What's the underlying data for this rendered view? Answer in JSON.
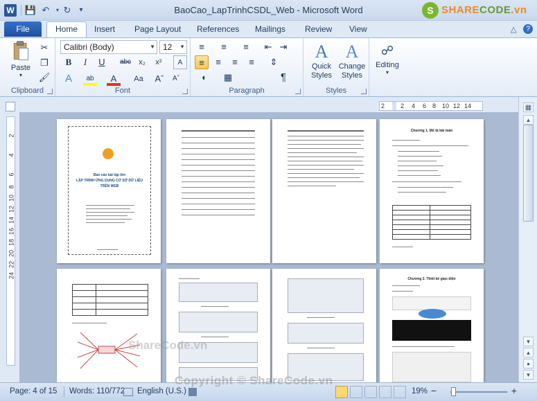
{
  "window": {
    "title": "BaoCao_LapTrinhCSDL_Web  -  Microsoft Word",
    "app_icon": "W",
    "brand_text_1": "SHARE",
    "brand_text_2": "CODE",
    "brand_text_3": ".vn"
  },
  "tabs": {
    "file": "File",
    "items": [
      "Home",
      "Insert",
      "Page Layout",
      "References",
      "Mailings",
      "Review",
      "View"
    ]
  },
  "ribbon": {
    "clipboard": {
      "label": "Clipboard",
      "paste": "Paste"
    },
    "font": {
      "label": "Font",
      "name": "Calibri (Body)",
      "size": "12"
    },
    "paragraph": {
      "label": "Paragraph"
    },
    "styles": {
      "label": "Styles",
      "quick_styles": "Quick Styles",
      "change_styles": "Change Styles"
    },
    "editing": {
      "label": "Editing"
    }
  },
  "ruler": {
    "h_ticks": [
      "2",
      "2",
      "4",
      "6",
      "8",
      "10",
      "12",
      "14"
    ],
    "v_ticks": [
      "2",
      "4",
      "6",
      "8",
      "10",
      "12",
      "14",
      "16",
      "18",
      "20",
      "22",
      "24"
    ]
  },
  "pages": {
    "cover_title_1": "Báo cáo bài tập lớn",
    "cover_title_2": "LẬP TRÌNH ỨNG DỤNG CƠ SỞ DỮ LIỆU",
    "cover_title_3": "TRÊN WEB",
    "chapter1": "Chương 1.    Mô tả bài toán",
    "chapter2": "Chương 2.    Thiết kế giao diện",
    "watermark_mid": "ShareCode.vn"
  },
  "status": {
    "page": "Page: 4 of 15",
    "words": "Words: 110/772",
    "language": "English (U.S.)",
    "zoom": "19%",
    "zoom_fraction": 0.19
  },
  "watermark": "Copyright © ShareCode.vn",
  "colors": {
    "file_tab": "#2b579a",
    "accent": "#f08a1c",
    "green": "#7ab82b"
  }
}
